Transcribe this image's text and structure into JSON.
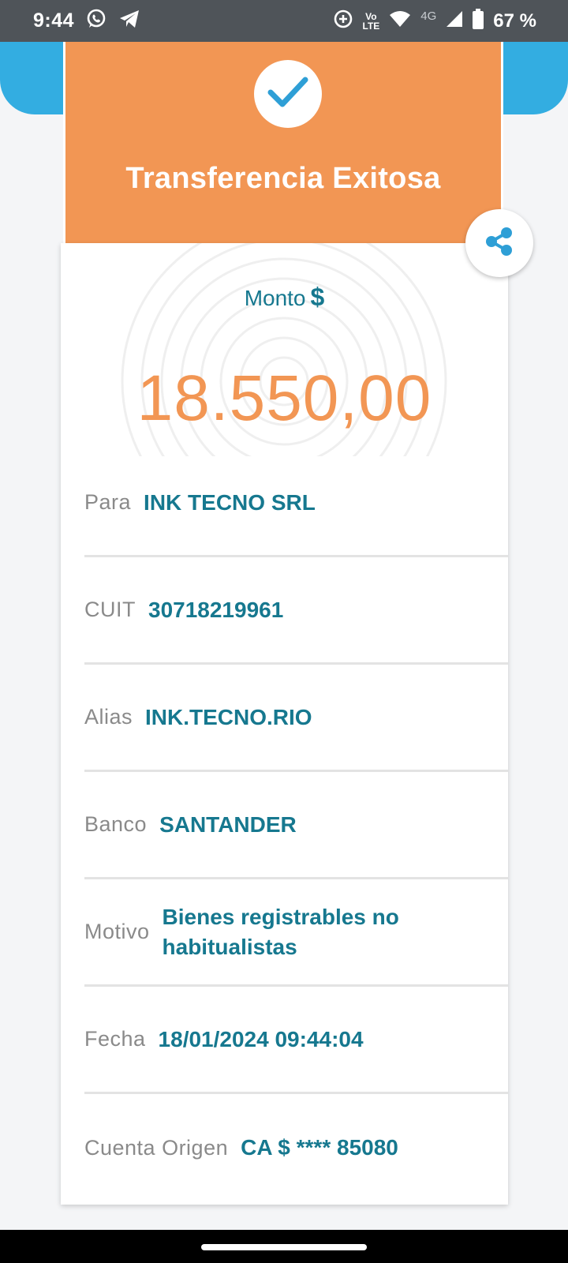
{
  "status_bar": {
    "time": "9:44",
    "volte_top": "Vo",
    "volte_bottom": "LTE",
    "network": "4G",
    "battery": "67 %"
  },
  "header": {
    "title": "Transferencia Exitosa",
    "accent_color": "#f29654",
    "brand_blue": "#33ade1"
  },
  "amount": {
    "label": "Monto",
    "currency": "$",
    "value": "18.550,00"
  },
  "details": [
    {
      "label": "Para",
      "value": "INK TECNO SRL"
    },
    {
      "label": "CUIT",
      "value": "30718219961"
    },
    {
      "label": "Alias",
      "value": "INK.TECNO.RIO"
    },
    {
      "label": "Banco",
      "value": "SANTANDER"
    },
    {
      "label": "Motivo",
      "value": "Bienes registrables no habitualistas"
    },
    {
      "label": "Fecha",
      "value": "18/01/2024 09:44:04"
    },
    {
      "label": "Cuenta Origen",
      "value": "CA $ **** 85080"
    }
  ],
  "icons": {
    "check": "check-icon",
    "share": "share-icon"
  }
}
